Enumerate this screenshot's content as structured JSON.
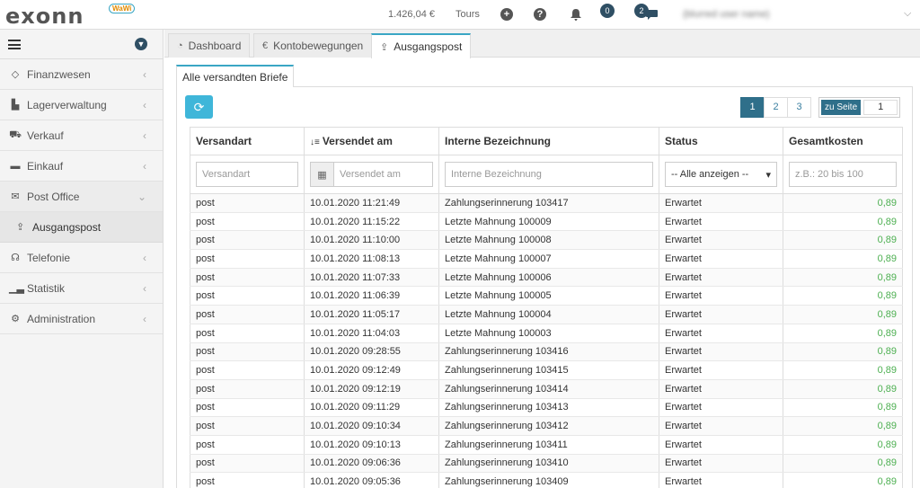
{
  "header": {
    "logo_text": "exonn",
    "logo_badge": "WaWi",
    "balance": "1.426,04 €",
    "tours_label": "Tours",
    "notif_badge_1": "0",
    "notif_badge_2": "2",
    "user_name": "(blurred user name)"
  },
  "sidebar": {
    "items": [
      {
        "label": "Finanzwesen",
        "icon": "coins-icon"
      },
      {
        "label": "Lagerverwaltung",
        "icon": "warehouse-icon"
      },
      {
        "label": "Verkauf",
        "icon": "cart-icon"
      },
      {
        "label": "Einkauf",
        "icon": "truck-icon"
      },
      {
        "label": "Post Office",
        "icon": "envelope-icon"
      },
      {
        "label": "Telefonie",
        "icon": "headset-icon"
      },
      {
        "label": "Statistik",
        "icon": "chart-icon"
      },
      {
        "label": "Administration",
        "icon": "cogs-icon"
      }
    ],
    "sub_item": "Ausgangspost"
  },
  "tabs": [
    {
      "label": "Dashboard"
    },
    {
      "label": "Kontobewegungen"
    },
    {
      "label": "Ausgangspost"
    }
  ],
  "subtab": "Alle versandten Briefe",
  "pager": {
    "pages": [
      "1",
      "2",
      "3"
    ],
    "goto_label": "zu Seite",
    "goto_value": "1"
  },
  "table": {
    "headers": [
      "Versandart",
      "Versendet am",
      "Interne Bezeichnung",
      "Status",
      "Gesamtkosten"
    ],
    "filters": {
      "versandart": "Versandart",
      "versendet": "Versendet am",
      "bezeichnung": "Interne Bezeichnung",
      "status": "-- Alle anzeigen --",
      "kosten": "z.B.: 20 bis 100"
    },
    "rows": [
      [
        "post",
        "10.01.2020 11:21:49",
        "Zahlungserinnerung 103417",
        "Erwartet",
        "0,89"
      ],
      [
        "post",
        "10.01.2020 11:15:22",
        "Letzte Mahnung 100009",
        "Erwartet",
        "0,89"
      ],
      [
        "post",
        "10.01.2020 11:10:00",
        "Letzte Mahnung 100008",
        "Erwartet",
        "0,89"
      ],
      [
        "post",
        "10.01.2020 11:08:13",
        "Letzte Mahnung 100007",
        "Erwartet",
        "0,89"
      ],
      [
        "post",
        "10.01.2020 11:07:33",
        "Letzte Mahnung 100006",
        "Erwartet",
        "0,89"
      ],
      [
        "post",
        "10.01.2020 11:06:39",
        "Letzte Mahnung 100005",
        "Erwartet",
        "0,89"
      ],
      [
        "post",
        "10.01.2020 11:05:17",
        "Letzte Mahnung 100004",
        "Erwartet",
        "0,89"
      ],
      [
        "post",
        "10.01.2020 11:04:03",
        "Letzte Mahnung 100003",
        "Erwartet",
        "0,89"
      ],
      [
        "post",
        "10.01.2020 09:28:55",
        "Zahlungserinnerung 103416",
        "Erwartet",
        "0,89"
      ],
      [
        "post",
        "10.01.2020 09:12:49",
        "Zahlungserinnerung 103415",
        "Erwartet",
        "0,89"
      ],
      [
        "post",
        "10.01.2020 09:12:19",
        "Zahlungserinnerung 103414",
        "Erwartet",
        "0,89"
      ],
      [
        "post",
        "10.01.2020 09:11:29",
        "Zahlungserinnerung 103413",
        "Erwartet",
        "0,89"
      ],
      [
        "post",
        "10.01.2020 09:10:34",
        "Zahlungserinnerung 103412",
        "Erwartet",
        "0,89"
      ],
      [
        "post",
        "10.01.2020 09:10:13",
        "Zahlungserinnerung 103411",
        "Erwartet",
        "0,89"
      ],
      [
        "post",
        "10.01.2020 09:06:36",
        "Zahlungserinnerung 103410",
        "Erwartet",
        "0,89"
      ],
      [
        "post",
        "10.01.2020 09:05:36",
        "Zahlungserinnerung 103409",
        "Erwartet",
        "0,89"
      ]
    ]
  },
  "colors": {
    "accent": "#3aa6c4",
    "brand_dark": "#2f6f8a",
    "cost_green": "#4caf50"
  }
}
